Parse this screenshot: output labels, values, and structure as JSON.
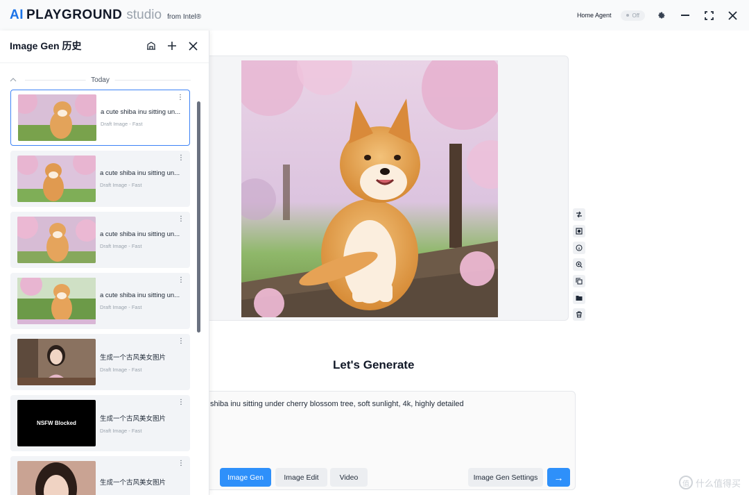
{
  "app": {
    "brand_ai": "AI",
    "brand_playground": "PLAYGROUND",
    "brand_studio": "studio",
    "brand_from": "from Intel®",
    "home_agent_label": "Home Agent",
    "home_agent_state": "Off"
  },
  "history": {
    "title": "Image Gen 历史",
    "group_label": "Today",
    "items": [
      {
        "title": "a cute shiba inu sitting un...",
        "sub": "Draft Image - Fast",
        "thumb": "shiba-sit"
      },
      {
        "title": "a cute shiba inu sitting un...",
        "sub": "Draft Image - Fast",
        "thumb": "shiba-front"
      },
      {
        "title": "a cute shiba inu sitting un...",
        "sub": "Draft Image - Fast",
        "thumb": "shiba-stand"
      },
      {
        "title": "a cute shiba inu sitting un...",
        "sub": "Draft Image - Fast",
        "thumb": "shiba-grass"
      },
      {
        "title": "生成一个古风美女图片",
        "sub": "Draft Image - Fast",
        "thumb": "girl-pink"
      },
      {
        "title": "生成一个古风美女图片",
        "sub": "Draft Image - Fast",
        "thumb": "nsfw",
        "thumb_text": "NSFW Blocked"
      },
      {
        "title": "生成一个古风美女图片",
        "sub": "",
        "thumb": "girl-portrait"
      }
    ]
  },
  "main": {
    "heading": "Let's Generate",
    "prompt": "shiba inu sitting under cherry blossom tree, soft sunlight, 4k, highly detailed",
    "mode_buttons": [
      "Image Gen",
      "Image Edit",
      "Video"
    ],
    "settings_label": "Image Gen Settings",
    "submit_label": "→"
  },
  "watermark": "什么值得买",
  "colors": {
    "accent": "#2e90fa",
    "brand_blue": "#1a73e8"
  }
}
